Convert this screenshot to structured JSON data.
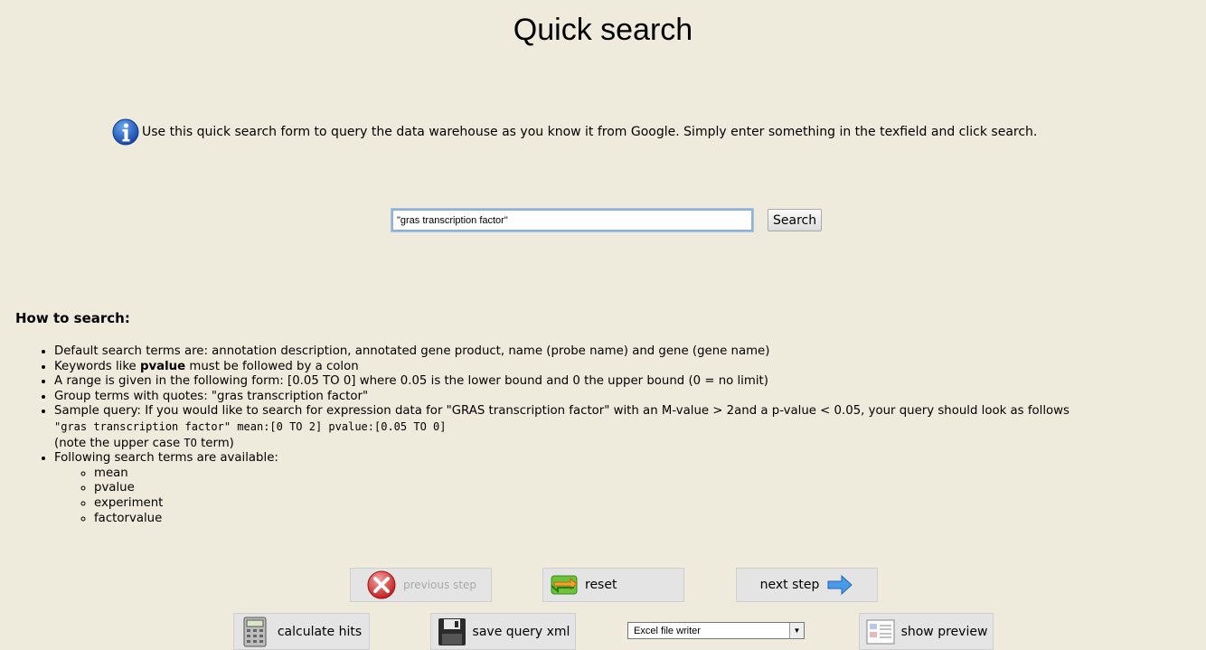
{
  "page": {
    "title": "Quick search"
  },
  "info": {
    "text": "Use this quick search form to query the data warehouse as you know it from Google. Simply enter something in the texfield and click search."
  },
  "search": {
    "value": "\"gras transcription factor\"",
    "button_label": "Search"
  },
  "howto": {
    "title": "How to search:",
    "item1": "Default search terms are: annotation description, annotated gene product, name (probe name) and gene (gene name)",
    "item2_pre": "Keywords like ",
    "item2_bold": "pvalue",
    "item2_post": " must be followed by a colon",
    "item3": "A range is given in the following form: [0.05 TO 0] where 0.05 is the lower bound and 0 the upper bound (0 = no limit)",
    "item4": "Group terms with quotes: \"gras transcription factor\"",
    "item5_text": "Sample query: If you would like to search for expression data for \"GRAS transcription factor\" with an M-value > 2and a p-value < 0.05, your query should look as follows",
    "item5_code": "\"gras transcription factor\" mean:[0 TO 2] pvalue:[0.05 TO 0]",
    "item5_note_pre": "(note the upper case ",
    "item5_note_code": "TO",
    "item5_note_post": " term)",
    "item6": "Following search terms are available:",
    "terms": [
      "mean",
      "pvalue",
      "experiment",
      "factorvalue"
    ]
  },
  "toolbar": {
    "previous_label": "previous step",
    "reset_label": "reset",
    "next_label": "next step",
    "calculate_label": "calculate hits",
    "save_label": "save query xml",
    "writer_selected": "Excel file writer",
    "preview_label": "show preview"
  }
}
